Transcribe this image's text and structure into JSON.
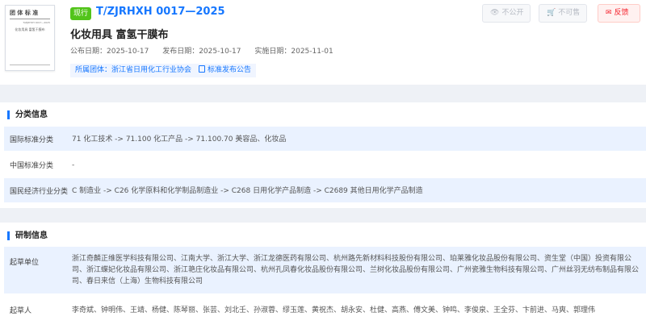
{
  "header": {
    "thumbnail": {
      "heading": "团 体 标 准",
      "code": "T/ZJRHXH 0017—2025",
      "caption": "化妆用具 富氢干膜布"
    },
    "status": "现行",
    "standard_no": "T/ZJRHXH 0017—2025",
    "title": "化妆用具 富氢干膜布",
    "published": "公布日期：2025-10-17",
    "issued": "发布日期：2025-10-17",
    "effective": "实施日期：2025-11-01",
    "org": "所属团体：浙江省日用化工行业协会",
    "notice": "标准发布公告",
    "buttons": {
      "private": "不公开",
      "nosale": "不可售",
      "feedback": "反馈"
    }
  },
  "classification": {
    "title": "分类信息",
    "rows": [
      {
        "label": "国际标准分类",
        "value": "71 化工技术 -> 71.100 化工产品 -> 71.100.70 美容品、化妆品"
      },
      {
        "label": "中国标准分类",
        "value": "-"
      },
      {
        "label": "国民经济行业分类",
        "value": "C 制造业 -> C26 化学原料和化学制品制造业 -> C268 日用化学产品制造 -> C2689 其他日用化学产品制造"
      }
    ]
  },
  "drafting": {
    "title": "研制信息",
    "rows": [
      {
        "label": "起草单位",
        "value": "浙江奇麟正维医学科技有限公司、江南大学、浙江大学、浙江龙德医药有限公司、杭州路先新材料科技股份有限公司、珀莱雅化妆品股份有限公司、资生堂（中国）投资有限公司、浙江蝶妃化妆品有限公司、浙江艳庄化妆品有限公司、杭州孔凤春化妆品股份有限公司、兰树化妆品股份有限公司、广州瓷雅生物科技有限公司、广州丝羽无纺布制品有限公司、春日来信（上海）生物科技有限公司"
      },
      {
        "label": "起草人",
        "value": "李奇斌、钟明伟、王靖、杨健、陈琴丽、张芸、刘北壬、孙淑蓉、缪玉莲、黄祝杰、胡永安、杜健、高燕、傅文美、钟鸣、李俊泉、王全芬、卞前进、马爽、郭理伟"
      }
    ]
  }
}
